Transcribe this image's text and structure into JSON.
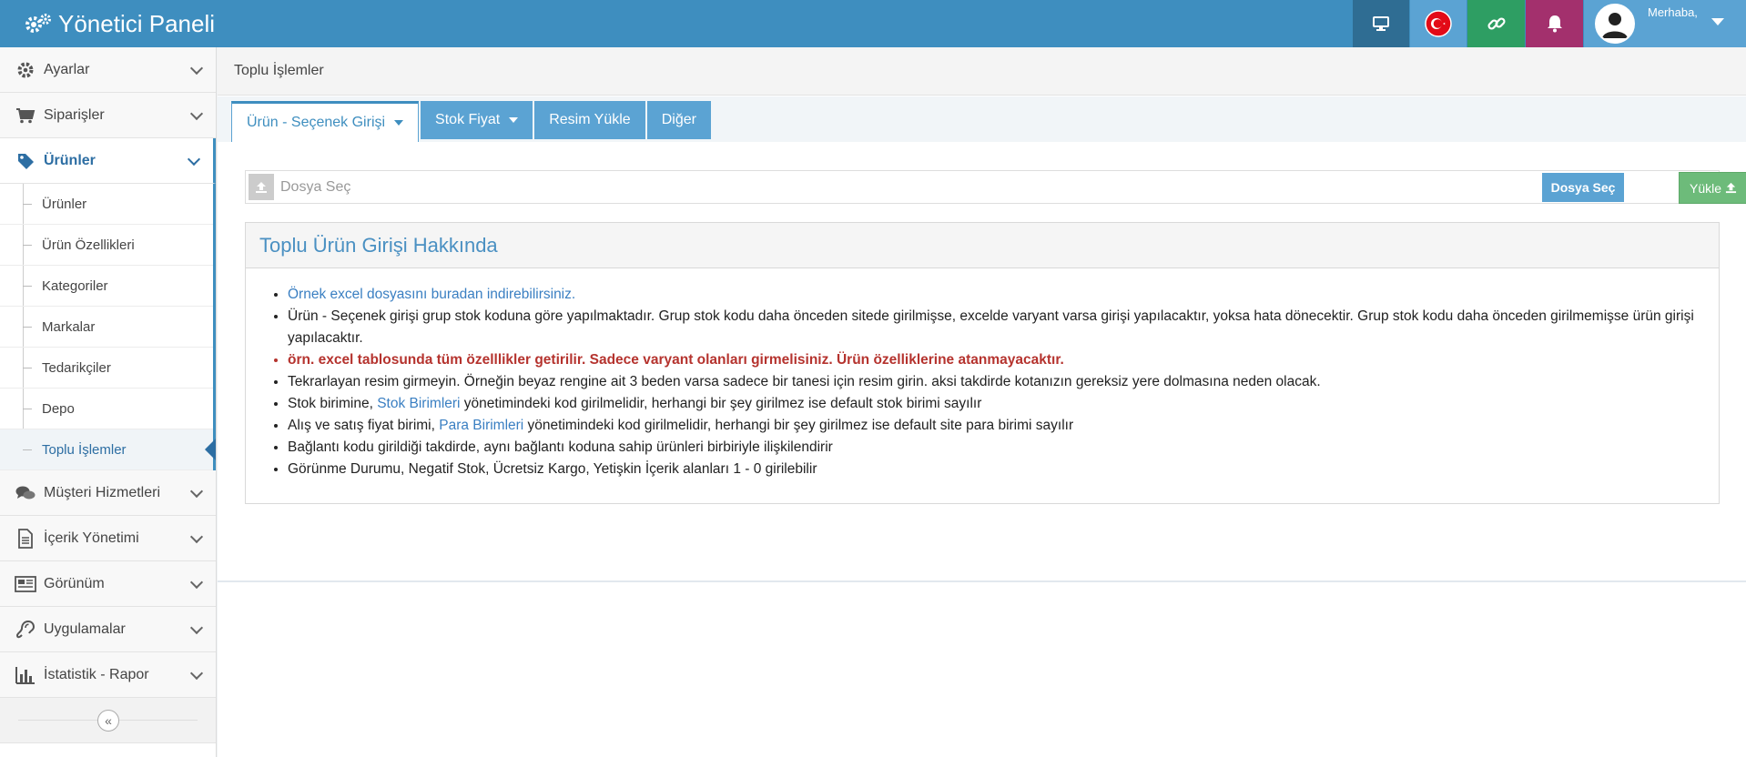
{
  "header": {
    "title": "Yönetici Paneli",
    "greeting": "Merhaba,"
  },
  "sidebar": {
    "items": [
      {
        "label": "Ayarlar",
        "icon": "gear-icon"
      },
      {
        "label": "Siparişler",
        "icon": "cart-icon"
      },
      {
        "label": "Ürünler",
        "icon": "tag-icon"
      },
      {
        "label": "Müşteri Hizmetleri",
        "icon": "chat-icon"
      },
      {
        "label": "İçerik Yönetimi",
        "icon": "document-icon"
      },
      {
        "label": "Görünüm",
        "icon": "newspaper-icon"
      },
      {
        "label": "Uygulamalar",
        "icon": "ear-icon"
      },
      {
        "label": "İstatistik - Rapor",
        "icon": "bar-chart-icon"
      }
    ],
    "submenu": [
      {
        "label": "Ürünler"
      },
      {
        "label": "Ürün Özellikleri"
      },
      {
        "label": "Kategoriler"
      },
      {
        "label": "Markalar"
      },
      {
        "label": "Tedarikçiler"
      },
      {
        "label": "Depo"
      },
      {
        "label": "Toplu İşlemler"
      }
    ]
  },
  "page": {
    "title": "Toplu İşlemler",
    "tabs": [
      {
        "label": "Ürün - Seçenek Girişi"
      },
      {
        "label": "Stok Fiyat"
      },
      {
        "label": "Resim Yükle"
      },
      {
        "label": "Diğer"
      }
    ],
    "file": {
      "placeholder": "Dosya Seç",
      "choose_label": "Dosya Seç",
      "upload_label": "Yükle"
    },
    "info": {
      "title": "Toplu Ürün Girişi Hakkında",
      "download_link": "Örnek excel dosyasını buradan indirebilirsiniz.",
      "line1": "Ürün - Seçenek girişi grup stok koduna göre yapılmaktadır. Grup stok kodu daha önceden sitede girilmişse, excelde varyant varsa girişi yapılacaktır, yoksa hata dönecektir. Grup stok kodu daha önceden girilmemişse ürün girişi yapılacaktır.",
      "warning": "örn. excel tablosunda tüm özelllikler getirilir. Sadece varyant olanları girmelisiniz. Ürün özelliklerine atanmayacaktır.",
      "line2": "Tekrarlayan resim girmeyin. Örneğin beyaz rengine ait 3 beden varsa sadece bir tanesi için resim girin. aksi takdirde kotanızın gereksiz yere dolmasına neden olacak.",
      "line3_pre": "Stok birimine, ",
      "line3_link": "Stok Birimleri",
      "line3_post": " yönetimindeki kod girilmelidir, herhangi bir şey girilmez ise default stok birimi sayılır",
      "line4_pre": "Alış ve satış fiyat birimi, ",
      "line4_link": "Para Birimleri",
      "line4_post": " yönetimindeki kod girilmelidir, herhangi bir şey girilmez ise default site para birimi sayılır",
      "line5": "Bağlantı kodu girildiği takdirde, aynı bağlantı koduna sahip ürünleri birbiriyle ilişkilendirir",
      "line6": "Görünme Durumu, Negatif Stok, Ücretsiz Kargo, Yetişkin İçerik alanları 1 - 0 girilebilir"
    }
  },
  "colors": {
    "primary": "#3e8ebf",
    "tab": "#5ba3d3",
    "success": "#6dbb7a",
    "notification": "#a3306d",
    "link_button": "#2e9e63",
    "warning_text": "#b5332e"
  }
}
